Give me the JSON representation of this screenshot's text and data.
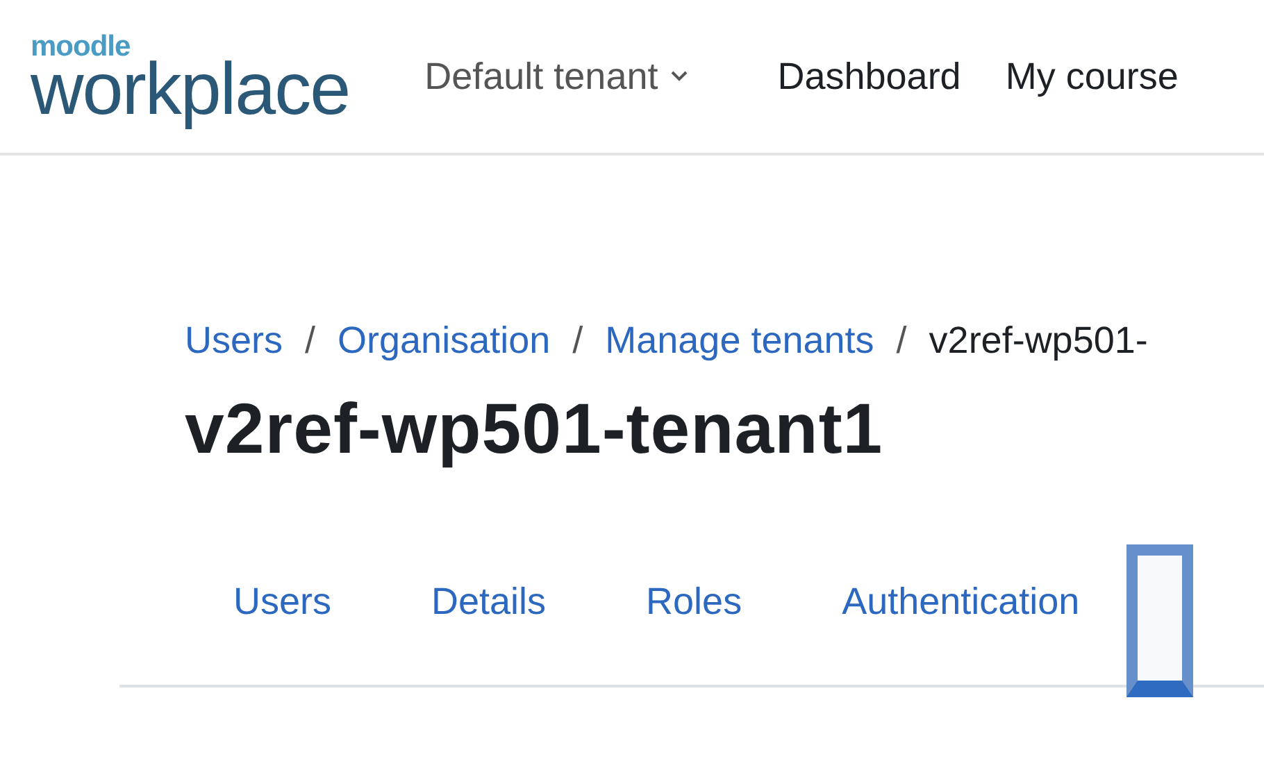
{
  "header": {
    "logo": {
      "top": "moodle",
      "bottom": "workplace"
    },
    "tenant_menu": "Default tenant",
    "nav": [
      "Dashboard",
      "My course"
    ]
  },
  "breadcrumb": [
    {
      "kind": "link",
      "label": "Users"
    },
    {
      "kind": "separator",
      "label": "/"
    },
    {
      "kind": "link",
      "label": "Organisation"
    },
    {
      "kind": "separator",
      "label": "/"
    },
    {
      "kind": "link",
      "label": "Manage tenants"
    },
    {
      "kind": "separator",
      "label": "/"
    },
    {
      "kind": "current",
      "label": "v2ref-wp501-"
    }
  ],
  "title": "v2ref-wp501-tenant1",
  "tabs": [
    {
      "label": "Users",
      "selected": false
    },
    {
      "label": "Details",
      "selected": false
    },
    {
      "label": "Roles",
      "selected": false
    },
    {
      "label": "Authentication",
      "selected": false
    },
    {
      "selected": true
    }
  ]
}
